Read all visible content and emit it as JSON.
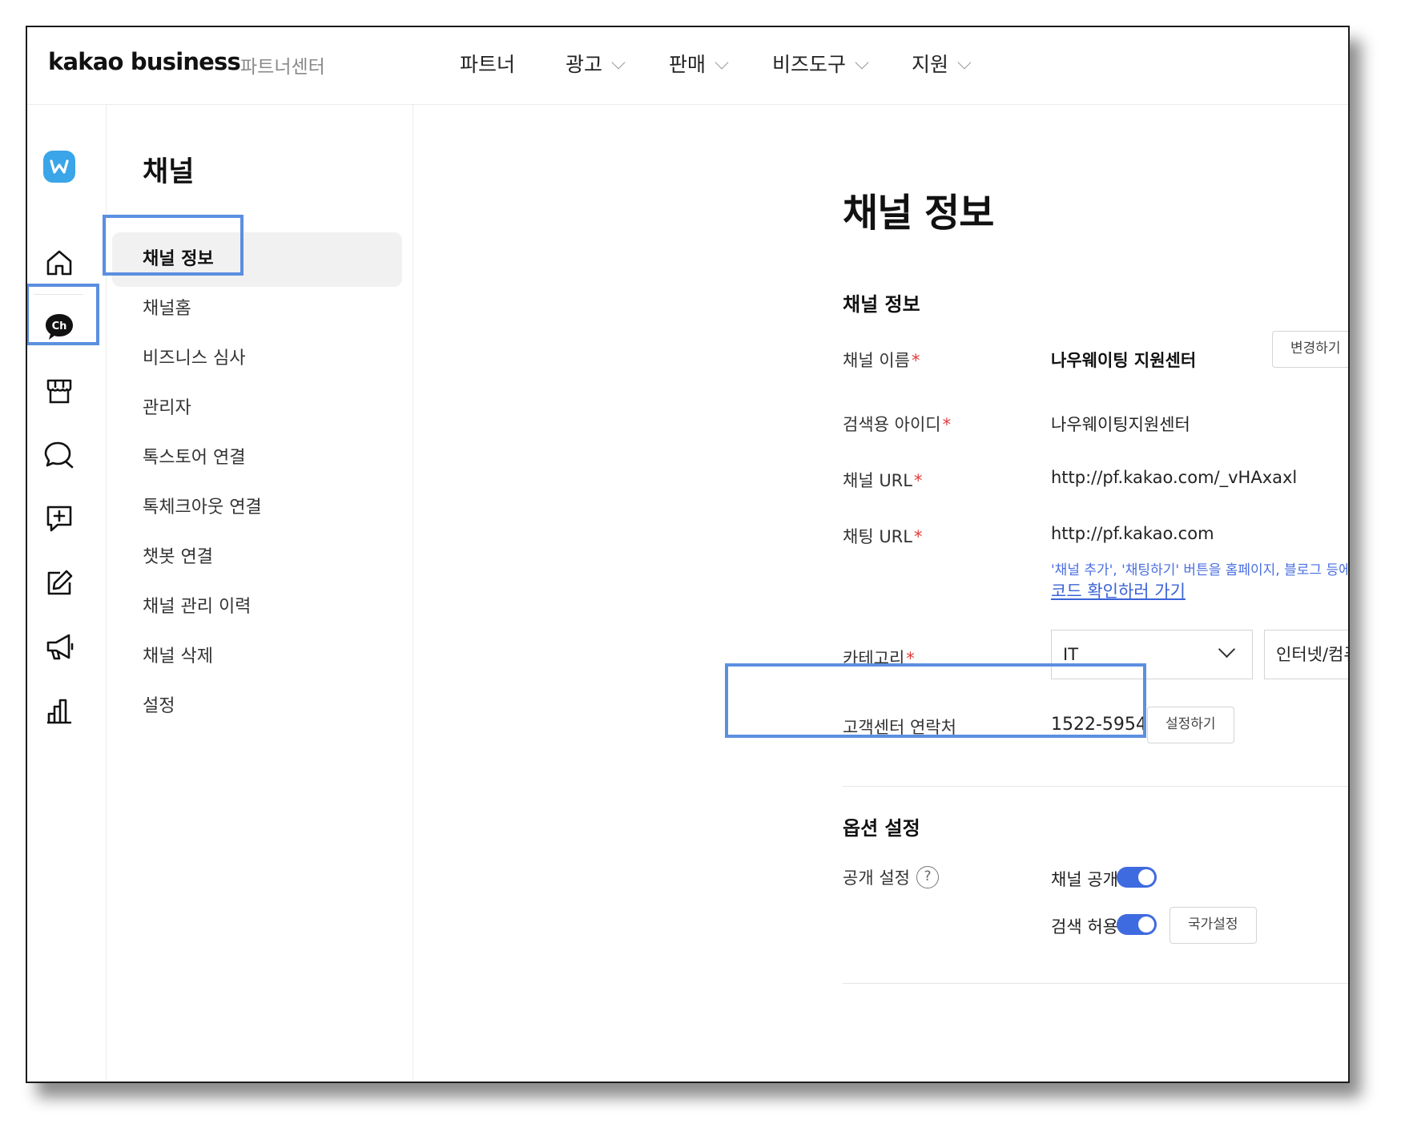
{
  "header": {
    "logo": "kakao business",
    "logo_sub": "파트너센터",
    "menu": [
      {
        "label": "파트너",
        "dropdown": false
      },
      {
        "label": "광고",
        "dropdown": true
      },
      {
        "label": "판매",
        "dropdown": true
      },
      {
        "label": "비즈도구",
        "dropdown": true
      },
      {
        "label": "지원",
        "dropdown": true
      }
    ]
  },
  "rail": {
    "items": [
      "workspace-icon",
      "home-icon",
      "channel-icon",
      "store-icon",
      "chat-icon",
      "add-chat-icon",
      "edit-icon",
      "megaphone-icon",
      "stats-icon"
    ],
    "accent": "#3aa5e8"
  },
  "subnav": {
    "title": "채널",
    "items": [
      {
        "label": "채널 정보",
        "active": true
      },
      {
        "label": "채널홈"
      },
      {
        "label": "비즈니스 심사"
      },
      {
        "label": "관리자"
      },
      {
        "label": "톡스토어 연결"
      },
      {
        "label": "톡체크아웃 연결"
      },
      {
        "label": "챗봇 연결"
      },
      {
        "label": "채널 관리 이력"
      },
      {
        "label": "채널 삭제"
      },
      {
        "label": "설정"
      }
    ]
  },
  "main": {
    "title": "채널 정보",
    "section_info": "채널 정보",
    "fields": {
      "name": {
        "label": "채널 이름",
        "value": "나우웨이팅 지원센터",
        "button": "변경하기"
      },
      "search_id": {
        "label": "검색용 아이디",
        "value": "나우웨이팅지원센터"
      },
      "channel_url": {
        "label": "채널 URL",
        "value": "http://pf.kakao.com/_vHAxaxl"
      },
      "chat_url": {
        "label": "채팅 URL",
        "value": "http://pf.kakao.com",
        "note": "'채널 추가', '채팅하기' 버튼을 홈페이지, 블로그 등에 노출",
        "link": "코드 확인하러 가기"
      },
      "category": {
        "label": "카테고리",
        "value1": "IT",
        "value2": "인터넷/컴퓨"
      },
      "contact": {
        "label": "고객센터 연락처",
        "value": "1522-5954",
        "button": "설정하기"
      }
    },
    "required_mark": "*",
    "section_options": "옵션 설정",
    "options": {
      "public_label": "공개 설정",
      "help_mark": "?",
      "channel_public": {
        "label": "채널 공개",
        "on": true
      },
      "search_allowed": {
        "label": "검색 허용",
        "on": true
      },
      "country_button": "국가설정"
    }
  },
  "colors": {
    "highlight": "#5b8fe0",
    "toggle_on": "#3f6be0",
    "required": "#e63a3a",
    "link": "#3b63d6"
  }
}
